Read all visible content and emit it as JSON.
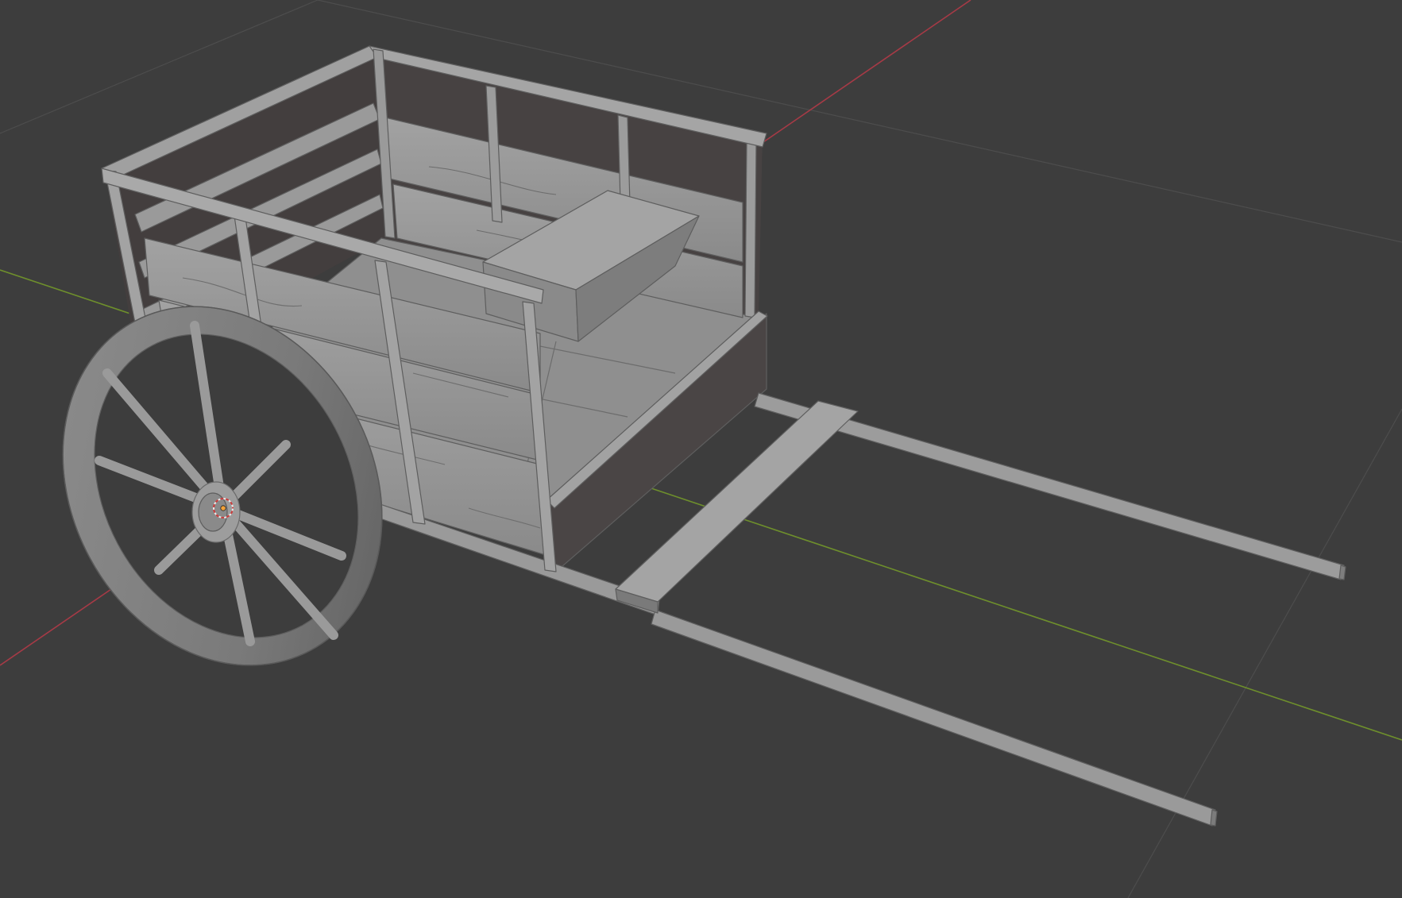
{
  "viewport": {
    "background": "#3d3d3d",
    "grid_color": "#4c4c4c",
    "x_axis_color": "#a63a46",
    "y_axis_color": "#6e8f2c"
  },
  "scene_object": {
    "name": "cart",
    "base_color": "#999999",
    "light_color": "#a8a8a8",
    "shadow_color": "#6d6d6d",
    "dark_color": "#464646",
    "edge_color": "#5a5a5a"
  },
  "icons": {
    "origin": "object-origin-icon",
    "cursor": "3d-cursor-icon"
  }
}
